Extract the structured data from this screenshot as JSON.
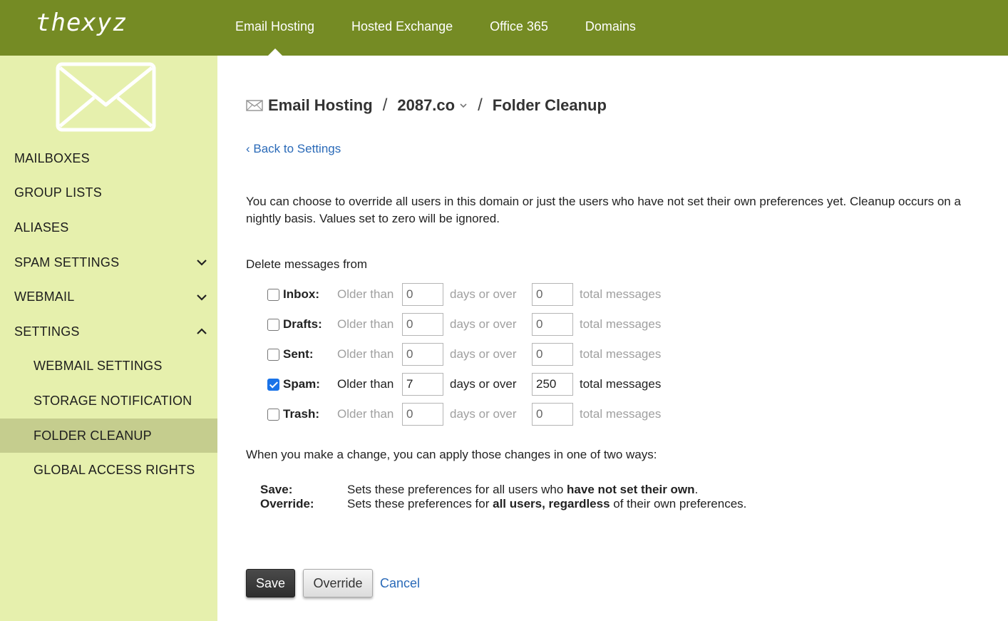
{
  "brand": {
    "logo_text": "thexyz",
    "color": "#758b24"
  },
  "nav": {
    "items": [
      {
        "label": "Email Hosting",
        "active": true
      },
      {
        "label": "Hosted Exchange",
        "active": false
      },
      {
        "label": "Office 365",
        "active": false
      },
      {
        "label": "Domains",
        "active": false
      }
    ]
  },
  "sidebar": {
    "icon": "envelope-icon",
    "items": [
      {
        "label": "MAILBOXES"
      },
      {
        "label": "GROUP LISTS"
      },
      {
        "label": "ALIASES"
      },
      {
        "label": "SPAM SETTINGS",
        "expanded": false
      },
      {
        "label": "WEBMAIL",
        "expanded": false
      },
      {
        "label": "SETTINGS",
        "expanded": true
      },
      {
        "label": "WEBMAIL SETTINGS"
      },
      {
        "label": "STORAGE NOTIFICATION"
      },
      {
        "label": "FOLDER CLEANUP",
        "active": true
      },
      {
        "label": "GLOBAL ACCESS RIGHTS"
      }
    ]
  },
  "breadcrumb": {
    "section": "Email Hosting",
    "domain": "2087.co",
    "page": "Folder Cleanup",
    "separator": "/"
  },
  "back_link": "‹ Back to Settings",
  "intro": "You can choose to override all users in this domain or just the users who have not set their own preferences yet. Cleanup occurs on a nightly basis. Values set to zero will be ignored.",
  "delete_label": "Delete messages from",
  "folders": [
    {
      "name": "Inbox:",
      "checked": false,
      "older_than_label": "Older than",
      "days": "0",
      "days_label": "days or over",
      "total": "0",
      "total_label": "total messages"
    },
    {
      "name": "Drafts:",
      "checked": false,
      "older_than_label": "Older than",
      "days": "0",
      "days_label": "days or over",
      "total": "0",
      "total_label": "total messages"
    },
    {
      "name": "Sent:",
      "checked": false,
      "older_than_label": "Older than",
      "days": "0",
      "days_label": "days or over",
      "total": "0",
      "total_label": "total messages"
    },
    {
      "name": "Spam:",
      "checked": true,
      "older_than_label": "Older than",
      "days": "7",
      "days_label": "days or over",
      "total": "250",
      "total_label": "total messages"
    },
    {
      "name": "Trash:",
      "checked": false,
      "older_than_label": "Older than",
      "days": "0",
      "days_label": "days or over",
      "total": "0",
      "total_label": "total messages"
    }
  ],
  "apply_text": "When you make a change, you can apply those changes in one of two ways:",
  "legend": {
    "save": {
      "key": "Save:",
      "pre": "Sets these preferences for all users who ",
      "bold": "have not set their own",
      "post": "."
    },
    "override": {
      "key": "Override:",
      "pre": "Sets these preferences for ",
      "bold": "all users, regardless",
      "post": " of their own preferences."
    }
  },
  "buttons": {
    "save": "Save",
    "override": "Override",
    "cancel": "Cancel"
  }
}
